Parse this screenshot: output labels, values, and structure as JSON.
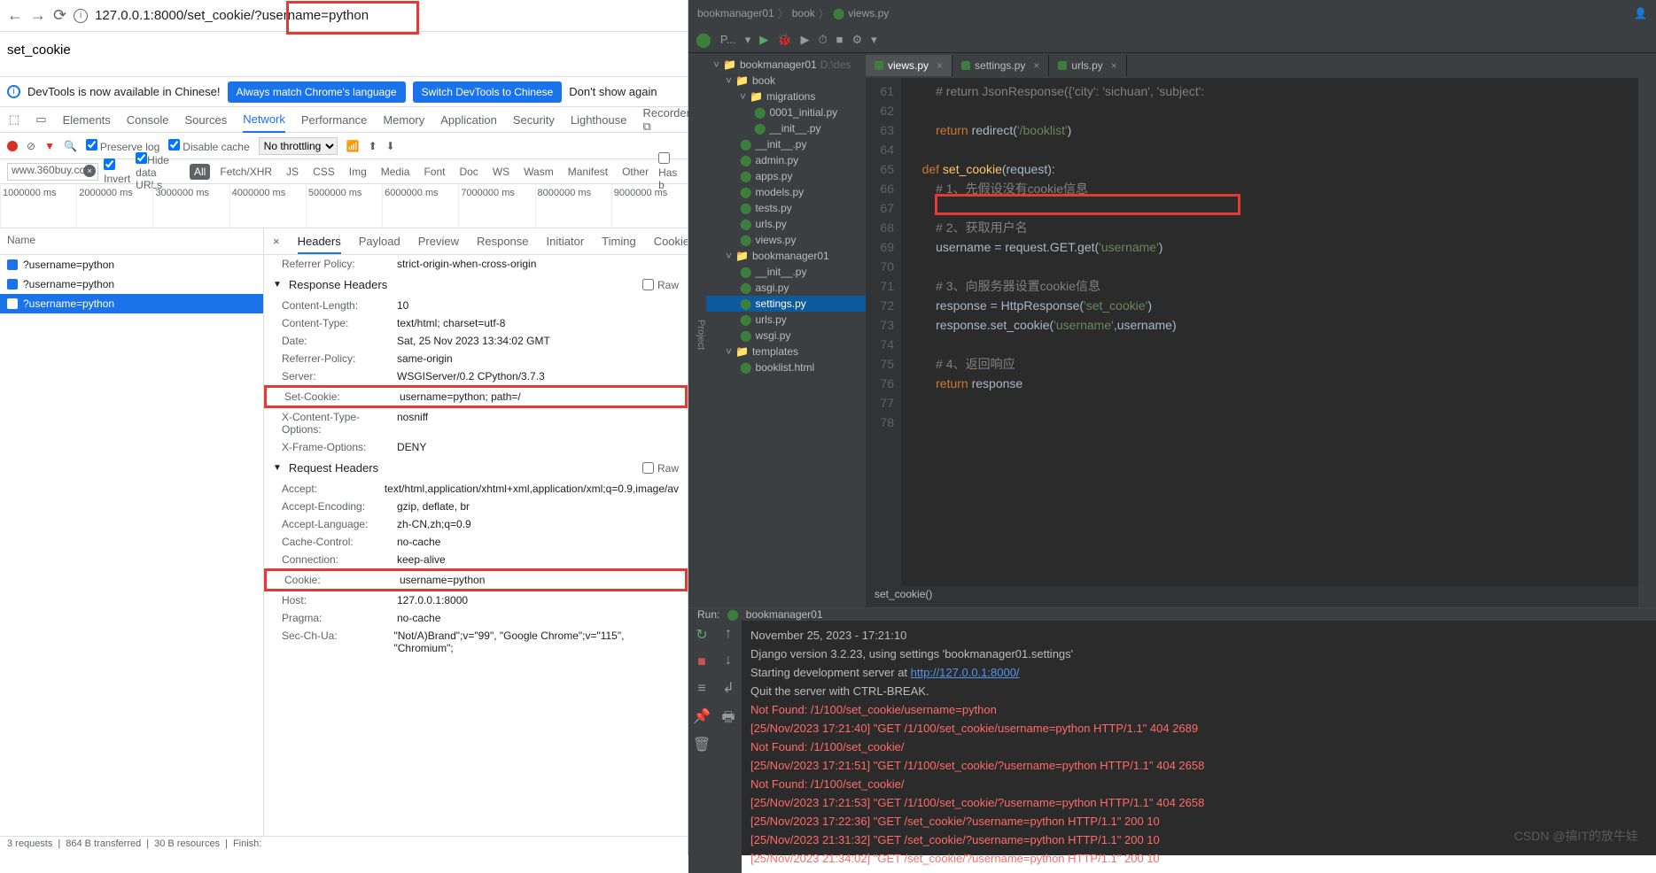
{
  "browser": {
    "url_prefix": "127.0.0.1:8000/set_cookie/",
    "url_query": "?username=python",
    "page_title": "set_cookie"
  },
  "infobar": {
    "text": "DevTools is now available in Chinese!",
    "btn1": "Always match Chrome's language",
    "btn2": "Switch DevTools to Chinese",
    "dismiss": "Don't show again"
  },
  "devtools_tabs": [
    "Elements",
    "Console",
    "Sources",
    "Network",
    "Performance",
    "Memory",
    "Application",
    "Security",
    "Lighthouse",
    "Recorder ⧉"
  ],
  "devtools_active": "Network",
  "net_toolbar": {
    "preserve": "Preserve log",
    "disable": "Disable cache",
    "throttle": "No throttling"
  },
  "net_toolbar2": {
    "filter_val": "www.360buy.com",
    "invert": "Invert",
    "hide": "Hide data URLs",
    "types": [
      "All",
      "Fetch/XHR",
      "JS",
      "CSS",
      "Img",
      "Media",
      "Font",
      "Doc",
      "WS",
      "Wasm",
      "Manifest",
      "Other"
    ],
    "hasb": "Has b"
  },
  "waterfall_ticks": [
    "1000000 ms",
    "2000000 ms",
    "3000000 ms",
    "4000000 ms",
    "5000000 ms",
    "6000000 ms",
    "7000000 ms",
    "8000000 ms",
    "9000000 ms"
  ],
  "reqlist_header": "Name",
  "requests": [
    "?username=python",
    "?username=python",
    "?username=python"
  ],
  "detail_tabs": [
    "Headers",
    "Payload",
    "Preview",
    "Response",
    "Initiator",
    "Timing",
    "Cookies"
  ],
  "detail_active": "Headers",
  "general": [
    {
      "k": "Referrer Policy:",
      "v": "strict-origin-when-cross-origin"
    }
  ],
  "resp_hdr_title": "Response Headers",
  "resp_headers": [
    {
      "k": "Content-Length:",
      "v": "10"
    },
    {
      "k": "Content-Type:",
      "v": "text/html; charset=utf-8"
    },
    {
      "k": "Date:",
      "v": "Sat, 25 Nov 2023 13:34:02 GMT"
    },
    {
      "k": "Referrer-Policy:",
      "v": "same-origin"
    },
    {
      "k": "Server:",
      "v": "WSGIServer/0.2 CPython/3.7.3"
    },
    {
      "k": "Set-Cookie:",
      "v": "username=python; path=/",
      "boxed": true
    },
    {
      "k": "X-Content-Type-Options:",
      "v": "nosniff"
    },
    {
      "k": "X-Frame-Options:",
      "v": "DENY"
    }
  ],
  "req_hdr_title": "Request Headers",
  "req_headers": [
    {
      "k": "Accept:",
      "v": "text/html,application/xhtml+xml,application/xml;q=0.9,image/av"
    },
    {
      "k": "Accept-Encoding:",
      "v": "gzip, deflate, br"
    },
    {
      "k": "Accept-Language:",
      "v": "zh-CN,zh;q=0.9"
    },
    {
      "k": "Cache-Control:",
      "v": "no-cache"
    },
    {
      "k": "Connection:",
      "v": "keep-alive"
    },
    {
      "k": "Cookie:",
      "v": "username=python",
      "boxed": true
    },
    {
      "k": "Host:",
      "v": "127.0.0.1:8000"
    },
    {
      "k": "Pragma:",
      "v": "no-cache"
    },
    {
      "k": "Sec-Ch-Ua:",
      "v": "\"Not/A)Brand\";v=\"99\", \"Google Chrome\";v=\"115\", \"Chromium\";"
    }
  ],
  "statusbar": [
    "3 requests",
    "864 B transferred",
    "30 B resources",
    "Finish:"
  ],
  "raw_label": "Raw",
  "ide": {
    "crumbs": [
      "bookmanager01",
      "book",
      "views.py"
    ],
    "toolbar_label": "P...",
    "tabs": [
      {
        "name": "views.py",
        "active": true
      },
      {
        "name": "settings.py",
        "active": false
      },
      {
        "name": "urls.py",
        "active": false
      }
    ],
    "tree": [
      {
        "lvl": 0,
        "type": "dir",
        "name": "bookmanager01",
        "exp": true,
        "suffix": "D:\\des"
      },
      {
        "lvl": 1,
        "type": "dir",
        "name": "book",
        "exp": true
      },
      {
        "lvl": 2,
        "type": "dir",
        "name": "migrations",
        "exp": true
      },
      {
        "lvl": 3,
        "type": "py",
        "name": "0001_initial.py"
      },
      {
        "lvl": 3,
        "type": "py",
        "name": "__init__.py"
      },
      {
        "lvl": 2,
        "type": "py",
        "name": "__init__.py"
      },
      {
        "lvl": 2,
        "type": "py",
        "name": "admin.py"
      },
      {
        "lvl": 2,
        "type": "py",
        "name": "apps.py"
      },
      {
        "lvl": 2,
        "type": "py",
        "name": "models.py"
      },
      {
        "lvl": 2,
        "type": "py",
        "name": "tests.py"
      },
      {
        "lvl": 2,
        "type": "py",
        "name": "urls.py"
      },
      {
        "lvl": 2,
        "type": "py",
        "name": "views.py"
      },
      {
        "lvl": 1,
        "type": "dir",
        "name": "bookmanager01",
        "exp": true
      },
      {
        "lvl": 2,
        "type": "py",
        "name": "__init__.py"
      },
      {
        "lvl": 2,
        "type": "py",
        "name": "asgi.py"
      },
      {
        "lvl": 2,
        "type": "py",
        "name": "settings.py",
        "sel": true
      },
      {
        "lvl": 2,
        "type": "py",
        "name": "urls.py"
      },
      {
        "lvl": 2,
        "type": "py",
        "name": "wsgi.py"
      },
      {
        "lvl": 1,
        "type": "dir",
        "name": "templates",
        "exp": true
      },
      {
        "lvl": 2,
        "type": "html",
        "name": "booklist.html"
      }
    ],
    "line_start": 61,
    "breadcrumb_fn": "set_cookie()",
    "code_lines": [
      {
        "n": 61,
        "html": "        <span class='cm'># return JsonResponse({'city': 'sichuan', 'subject': </span>"
      },
      {
        "n": 62,
        "html": ""
      },
      {
        "n": 63,
        "html": "        <span class='kw'>return</span> redirect(<span class='str'>'/booklist'</span>)"
      },
      {
        "n": 64,
        "html": ""
      },
      {
        "n": 65,
        "html": "    <span class='kw'>def</span> <span class='fn'>set_cookie</span>(request):"
      },
      {
        "n": 66,
        "html": "        <span class='cm'># 1、先假设没有cookie信息</span>"
      },
      {
        "n": 67,
        "html": ""
      },
      {
        "n": 68,
        "html": "        <span class='cm'># 2、获取用户名</span>"
      },
      {
        "n": 69,
        "html": "        username = request.GET.get(<span class='str'>'username'</span>)"
      },
      {
        "n": 70,
        "html": ""
      },
      {
        "n": 71,
        "html": "        <span class='cm'># 3、向服务器设置cookie信息</span>"
      },
      {
        "n": 72,
        "html": "        response = HttpResponse(<span class='str'>'set_cookie'</span>)"
      },
      {
        "n": 73,
        "html": "        response.set_cookie(<span class='str'>'username'</span>,username)"
      },
      {
        "n": 74,
        "html": ""
      },
      {
        "n": 75,
        "html": "        <span class='cm'># 4、返回响应</span>"
      },
      {
        "n": 76,
        "html": "        <span class='kw'>return</span> response"
      },
      {
        "n": 77,
        "html": ""
      },
      {
        "n": 78,
        "html": ""
      }
    ],
    "run": {
      "title": "Run:",
      "config": "bookmanager01",
      "lines": [
        {
          "t": "November 25, 2023 - 17:21:10",
          "cls": ""
        },
        {
          "t": "Django version 3.2.23, using settings 'bookmanager01.settings'",
          "cls": ""
        },
        {
          "t": "Starting development server at ",
          "link": "http://127.0.0.1:8000/",
          "cls": ""
        },
        {
          "t": "Quit the server with CTRL-BREAK.",
          "cls": ""
        },
        {
          "t": "Not Found: /1/100/set_cookie/username=python",
          "cls": "err"
        },
        {
          "t": "[25/Nov/2023 17:21:40] \"GET /1/100/set_cookie/username=python HTTP/1.1\" 404 2689",
          "cls": "err"
        },
        {
          "t": "Not Found: /1/100/set_cookie/",
          "cls": "err"
        },
        {
          "t": "[25/Nov/2023 17:21:51] \"GET /1/100/set_cookie/?username=python HTTP/1.1\" 404 2658",
          "cls": "err"
        },
        {
          "t": "Not Found: /1/100/set_cookie/",
          "cls": "err"
        },
        {
          "t": "[25/Nov/2023 17:21:53] \"GET /1/100/set_cookie/?username=python HTTP/1.1\" 404 2658",
          "cls": "err"
        },
        {
          "t": "[25/Nov/2023 17:22:36] \"GET /set_cookie/?username=python HTTP/1.1\" 200 10",
          "cls": "err"
        },
        {
          "t": "[25/Nov/2023 21:31:32] \"GET /set_cookie/?username=python HTTP/1.1\" 200 10",
          "cls": "err"
        },
        {
          "t": "[25/Nov/2023 21:34:02] \"GET /set_cookie/?username=python HTTP/1.1\" 200 10",
          "cls": "err"
        }
      ]
    }
  },
  "watermark": "CSDN @搞IT的放牛娃"
}
